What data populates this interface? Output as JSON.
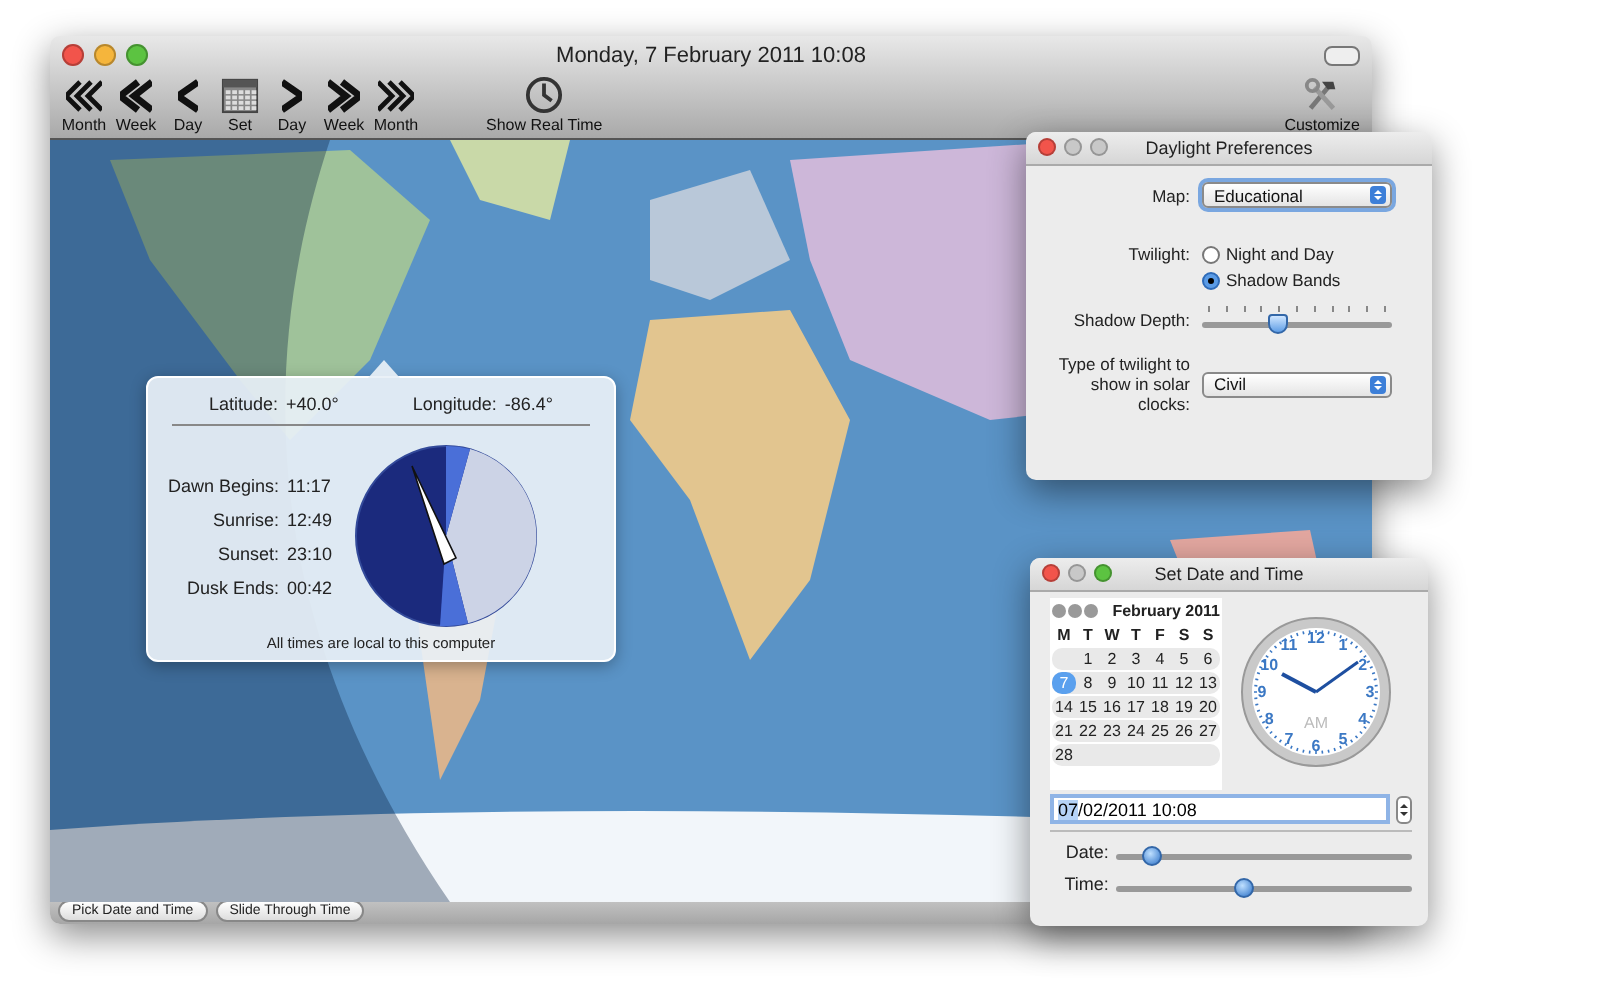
{
  "window": {
    "title": "Monday, 7 February 2011 10:08"
  },
  "toolbar": [
    {
      "label": "Month",
      "kind": "triple-left"
    },
    {
      "label": "Week",
      "kind": "double-left"
    },
    {
      "label": "Day",
      "kind": "single-left"
    },
    {
      "label": "Set",
      "kind": "calendar"
    },
    {
      "label": "Day",
      "kind": "single-right"
    },
    {
      "label": "Week",
      "kind": "double-right"
    },
    {
      "label": "Month",
      "kind": "triple-right"
    },
    {
      "label": "Show Real Time",
      "kind": "clock"
    },
    {
      "label": "Customize",
      "kind": "tools"
    }
  ],
  "location_popover": {
    "latitude_label": "Latitude:",
    "latitude": "+40.0°",
    "longitude_label": "Longitude:",
    "longitude": "-86.4°",
    "times": [
      {
        "label": "Dawn Begins:",
        "value": "11:17"
      },
      {
        "label": "Sunrise:",
        "value": "12:49"
      },
      {
        "label": "Sunset:",
        "value": "23:10"
      },
      {
        "label": "Dusk Ends:",
        "value": "00:42"
      }
    ],
    "note": "All times are local to this computer"
  },
  "bottom_buttons": [
    "Pick Date and Time",
    "Slide Through Time"
  ],
  "preferences": {
    "title": "Daylight Preferences",
    "map_label": "Map:",
    "map_value": "Educational",
    "twilight_label": "Twilight:",
    "twilight_options": [
      {
        "label": "Night and Day",
        "selected": false
      },
      {
        "label": "Shadow Bands",
        "selected": true
      }
    ],
    "shadow_depth_label": "Shadow Depth:",
    "shadow_depth": {
      "level": 0.4
    },
    "clock_type_label": "Type of twilight to show in solar clocks:",
    "clock_type_value": "Civil"
  },
  "set_date": {
    "title": "Set Date and Time",
    "month": "February 2011",
    "weekdays": [
      "M",
      "T",
      "W",
      "T",
      "F",
      "S",
      "S"
    ],
    "weeks": [
      [
        {
          "day": "1",
          "selected": false
        },
        {
          "day": "2",
          "selected": false
        },
        {
          "day": "3",
          "selected": false
        },
        {
          "day": "4",
          "selected": false
        },
        {
          "day": "5",
          "selected": false
        },
        {
          "day": "6",
          "selected": false
        }
      ],
      [
        {
          "day": "7",
          "selected": true
        },
        {
          "day": "8",
          "selected": false
        },
        {
          "day": "9",
          "selected": false
        },
        {
          "day": "10",
          "selected": false
        },
        {
          "day": "11",
          "selected": false
        },
        {
          "day": "12",
          "selected": false
        },
        {
          "day": "13",
          "selected": false
        }
      ],
      [
        {
          "day": "14",
          "selected": false
        },
        {
          "day": "15",
          "selected": false
        },
        {
          "day": "16",
          "selected": false
        },
        {
          "day": "17",
          "selected": false
        },
        {
          "day": "18",
          "selected": false
        },
        {
          "day": "19",
          "selected": false
        },
        {
          "day": "20",
          "selected": false
        }
      ],
      [
        {
          "day": "21",
          "selected": false
        },
        {
          "day": "22",
          "selected": false
        },
        {
          "day": "23",
          "selected": false
        },
        {
          "day": "24",
          "selected": false
        },
        {
          "day": "25",
          "selected": false
        },
        {
          "day": "26",
          "selected": false
        },
        {
          "day": "27",
          "selected": false
        }
      ],
      [
        {
          "day": "28",
          "selected": false
        }
      ]
    ],
    "clock_numbers": [
      "12",
      "11",
      "1",
      "10",
      "2",
      "9",
      "3",
      "8",
      "4",
      "7",
      "5",
      "6"
    ],
    "clock_period": "AM",
    "field": [
      {
        "text": "07",
        "selected": true
      },
      {
        "text": "/02/2011 10:08",
        "selected": false
      }
    ],
    "date_label": "Date:",
    "date_slider": {
      "level": 0.12
    },
    "time_label": "Time:",
    "time_slider": {
      "level": 0.43
    }
  }
}
